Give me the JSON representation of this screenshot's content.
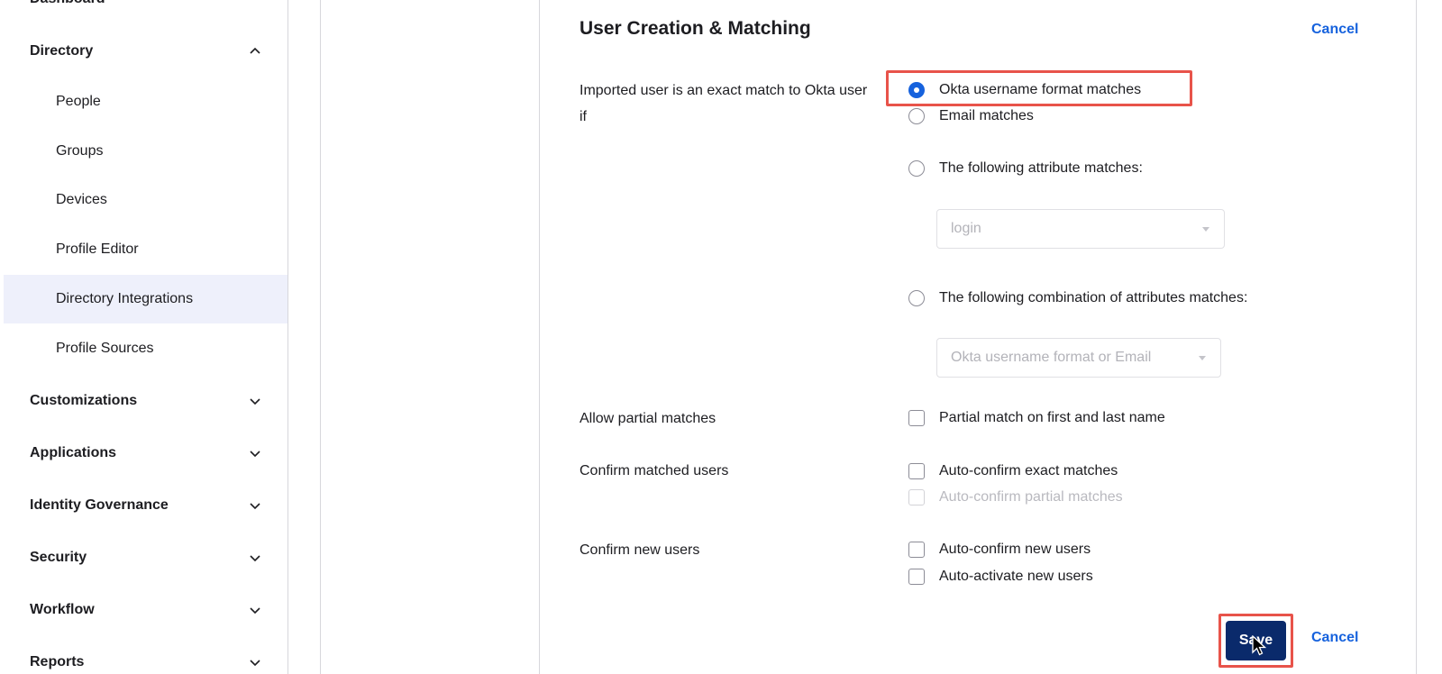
{
  "sidebar": {
    "cut_item": "Dashboard",
    "directory": "Directory",
    "directory_items": [
      {
        "label": "People"
      },
      {
        "label": "Groups"
      },
      {
        "label": "Devices"
      },
      {
        "label": "Profile Editor"
      },
      {
        "label": "Directory Integrations",
        "active": true
      },
      {
        "label": "Profile Sources"
      }
    ],
    "sections": [
      "Customizations",
      "Applications",
      "Identity Governance",
      "Security",
      "Workflow",
      "Reports"
    ]
  },
  "panel": {
    "title": "User Creation & Matching",
    "cancel_top": "Cancel",
    "exact_match_label": "Imported user is an exact match to Okta user if",
    "match_options": [
      {
        "label": "Okta username format matches",
        "selected": true
      },
      {
        "label": "Email matches",
        "selected": false
      },
      {
        "label": "The following attribute matches:",
        "selected": false
      },
      {
        "label": "The following combination of attributes matches:",
        "selected": false
      }
    ],
    "attribute_select": "login",
    "combination_select": "Okta username format or Email",
    "partial_label": "Allow partial matches",
    "partial_option": "Partial match on first and last name",
    "confirm_matched_label": "Confirm matched users",
    "confirm_matched_options": [
      "Auto-confirm exact matches",
      "Auto-confirm partial matches"
    ],
    "confirm_new_label": "Confirm new users",
    "confirm_new_options": [
      "Auto-confirm new users",
      "Auto-activate new users"
    ],
    "save": "Save",
    "cancel_bottom": "Cancel"
  },
  "colors": {
    "accent": "#1662dd",
    "save_bg": "#0a2a6b",
    "highlight": "#e8534a",
    "active_bg": "#eef0fb"
  }
}
